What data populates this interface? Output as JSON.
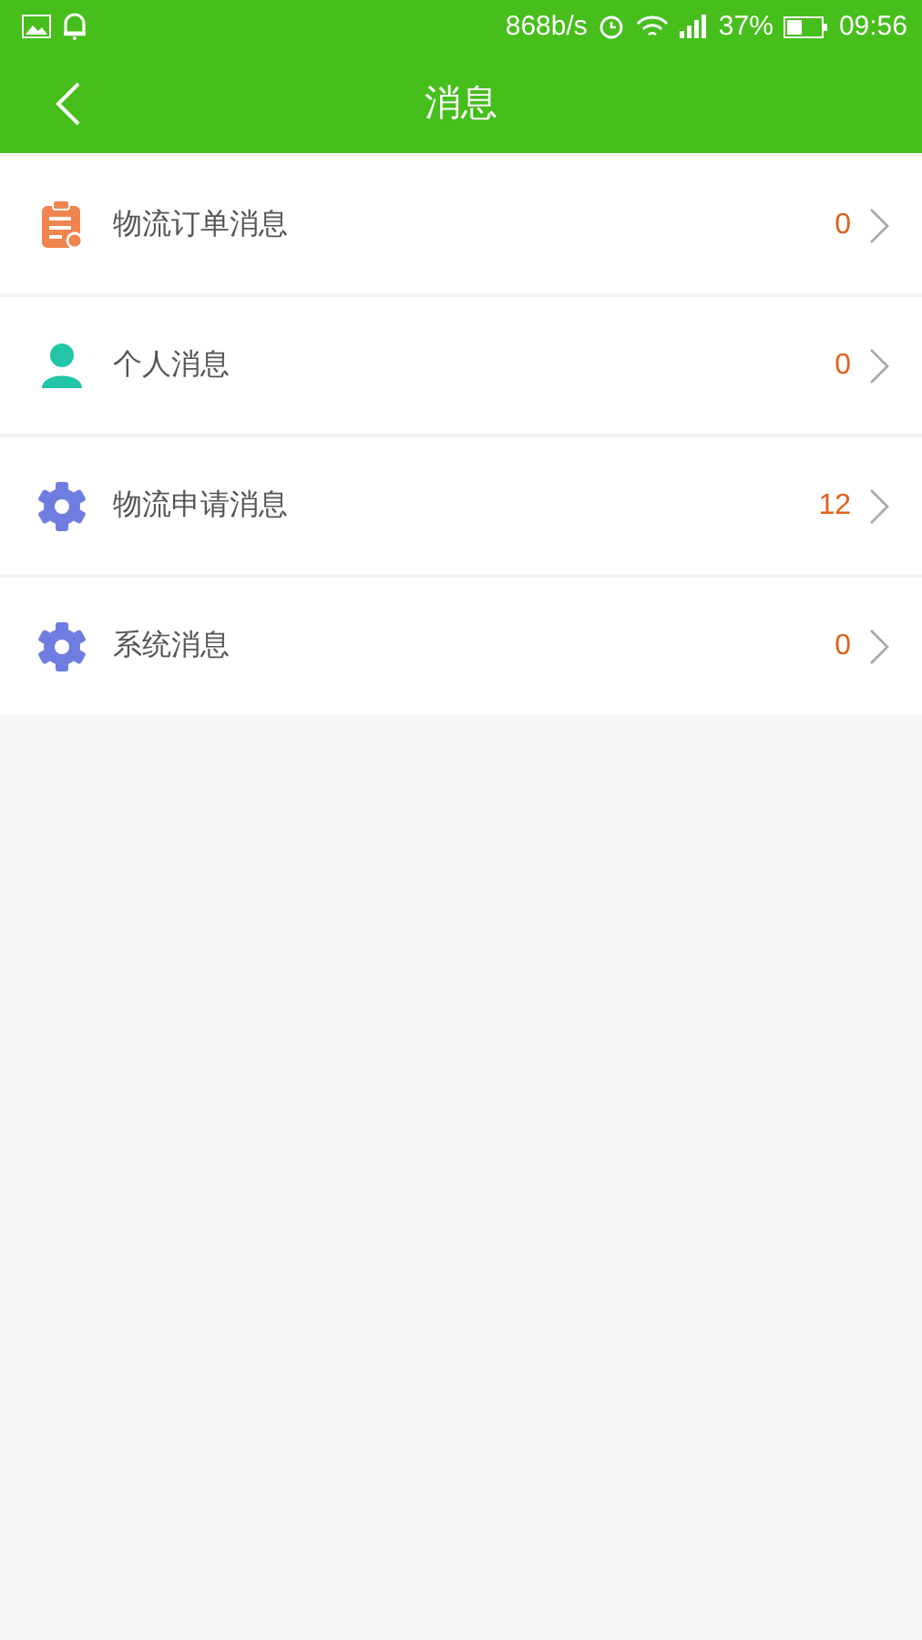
{
  "status_bar": {
    "speed": "868b/s",
    "battery": "37%",
    "time": "09:56"
  },
  "header": {
    "title": "消息"
  },
  "items": [
    {
      "kind": "clipboard",
      "label": "物流订单消息",
      "count": "0"
    },
    {
      "kind": "person",
      "label": "个人消息",
      "count": "0"
    },
    {
      "kind": "gear",
      "label": "物流申请消息",
      "count": "12"
    },
    {
      "kind": "gear",
      "label": "系统消息",
      "count": "0"
    }
  ]
}
